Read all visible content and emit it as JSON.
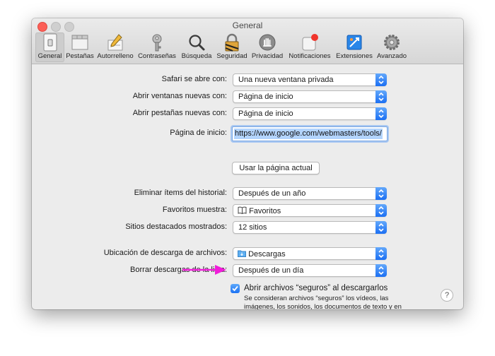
{
  "window": {
    "title": "General"
  },
  "toolbar": {
    "tabs": [
      {
        "label": "General",
        "icon": "general-switch-icon",
        "selected": true
      },
      {
        "label": "Pestañas",
        "icon": "tabs-icon"
      },
      {
        "label": "Autorrelleno",
        "icon": "pencil-icon"
      },
      {
        "label": "Contraseñas",
        "icon": "key-icon"
      },
      {
        "label": "Búsqueda",
        "icon": "magnifier-icon"
      },
      {
        "label": "Seguridad",
        "icon": "lock-icon"
      },
      {
        "label": "Privacidad",
        "icon": "hand-icon"
      },
      {
        "label": "Notificaciones",
        "icon": "notification-badge-icon"
      },
      {
        "label": "Extensiones",
        "icon": "puzzle-icon"
      },
      {
        "label": "Avanzado",
        "icon": "gear-icon"
      }
    ]
  },
  "settings": {
    "safari_opens_label": "Safari se abre con:",
    "safari_opens_value": "Una nueva ventana privada",
    "new_windows_label": "Abrir ventanas nuevas con:",
    "new_windows_value": "Página de inicio",
    "new_tabs_label": "Abrir pestañas nuevas con:",
    "new_tabs_value": "Página de inicio",
    "homepage_label": "Página de inicio:",
    "homepage_value": "https://www.google.com/webmasters/tools/",
    "use_current_button": "Usar la página actual",
    "remove_history_label": "Eliminar ítems del historial:",
    "remove_history_value": "Después de un año",
    "favorites_label": "Favoritos muestra:",
    "favorites_value": "Favoritos",
    "top_sites_label": "Sitios destacados mostrados:",
    "top_sites_value": "12 sitios",
    "download_location_label": "Ubicación de descarga de archivos:",
    "download_location_value": "Descargas",
    "remove_downloads_label": "Borrar descargas de la lista:",
    "remove_downloads_value": "Después de un día",
    "open_safe_label": "Abrir archivos “seguros” al descargarlos",
    "open_safe_checked": true,
    "open_safe_note": "Se consideran archivos “seguros” los vídeos, las imágenes, los sonidos, los documentos de texto y en formato PDF y los archivos comprimidos.",
    "help_label": "?"
  },
  "colors": {
    "accent": "#1b72f3",
    "annotation_arrow": "#f01ed9",
    "close": "#fc5f57"
  }
}
